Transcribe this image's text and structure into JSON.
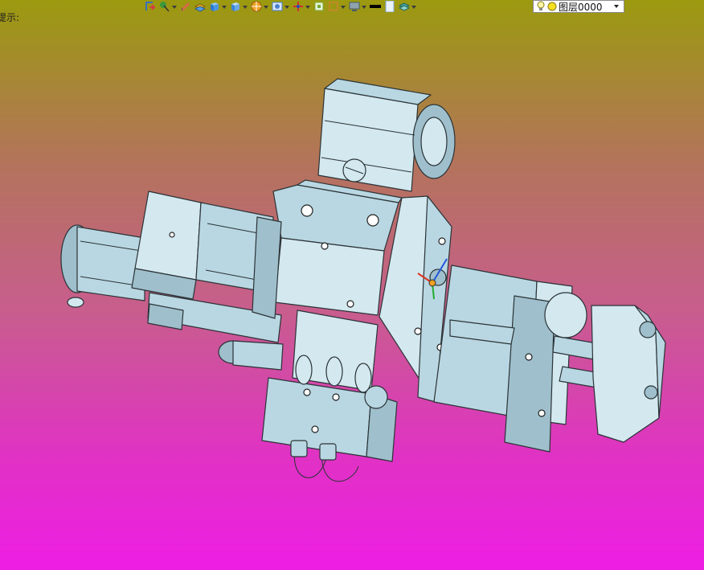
{
  "status_bar": {
    "hint_text": "提示:"
  },
  "toolbar": {
    "buttons": [
      {
        "name": "exit-sketch-icon",
        "color": "#d24040",
        "has_dropdown": false
      },
      {
        "name": "selection-filter-icon",
        "color": "#3c9a3c",
        "has_dropdown": true
      },
      {
        "name": "pencil-icon",
        "color": "#d9664a",
        "has_dropdown": false
      },
      {
        "name": "layers-stack-icon",
        "color": "#f0b020",
        "has_dropdown": false
      },
      {
        "name": "solid-cube-icon",
        "color": "#2a7ad0",
        "has_dropdown": true
      },
      {
        "name": "view-cube-icon",
        "color": "#3a86d8",
        "has_dropdown": true
      },
      {
        "name": "render-sphere-icon",
        "color": "#f0a020",
        "has_dropdown": true
      },
      {
        "name": "image-icon",
        "color": "#4a7fd0",
        "has_dropdown": true
      },
      {
        "name": "origin-axes-icon",
        "color": "#d03030",
        "has_dropdown": true
      },
      {
        "name": "plane-icon",
        "color": "#78a83c",
        "has_dropdown": false
      },
      {
        "name": "box-frame-icon",
        "color": "#c08a28",
        "has_dropdown": true
      },
      {
        "name": "monitor-icon",
        "color": "#6a7d8a",
        "has_dropdown": true
      },
      {
        "name": "line-weight-icon",
        "color": "#000000",
        "has_dropdown": false
      },
      {
        "name": "page-icon",
        "color": "#7fa6d8",
        "has_dropdown": false
      },
      {
        "name": "layer-manager-icon",
        "color": "#4aa6a0",
        "has_dropdown": true
      }
    ],
    "layer_selector": {
      "value": "图层0000",
      "bulb_icon": "lightbulb-icon",
      "status_icon": "layer-status-icon"
    }
  },
  "colors": {
    "model_fill": "#b9d7e2",
    "model_edge": "#2a3336",
    "background_top": "#9b9a0f",
    "background_bottom": "#ee1ee4"
  }
}
